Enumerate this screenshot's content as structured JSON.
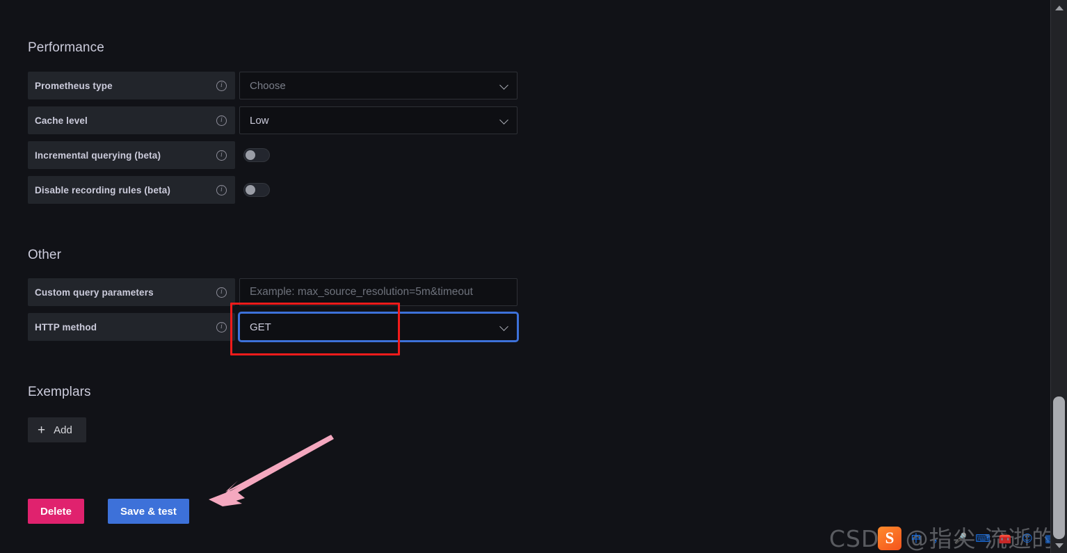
{
  "page": {
    "background": "#111217",
    "app": "Grafana Prometheus data source settings"
  },
  "sections": [
    {
      "id": "performance",
      "title": "Performance",
      "fields": [
        {
          "label": "Prometheus type",
          "info_icon": "info-icon",
          "control": "select",
          "value": "Choose",
          "is_placeholder": true,
          "focused": false
        },
        {
          "label": "Cache level",
          "info_icon": "info-icon",
          "control": "select",
          "value": "Low",
          "is_placeholder": false,
          "focused": false
        },
        {
          "label": "Incremental querying (beta)",
          "info_icon": "info-icon",
          "control": "toggle",
          "value": "off"
        },
        {
          "label": "Disable recording rules (beta)",
          "info_icon": "info-icon",
          "control": "toggle",
          "value": "off"
        }
      ]
    },
    {
      "id": "other",
      "title": "Other",
      "fields": [
        {
          "label": "Custom query parameters",
          "info_icon": "info-icon",
          "control": "text",
          "value": "",
          "placeholder": "Example: max_source_resolution=5m&timeout"
        },
        {
          "label": "HTTP method",
          "info_icon": "info-icon",
          "control": "select",
          "value": "GET",
          "is_placeholder": false,
          "focused": true
        }
      ]
    },
    {
      "id": "exemplars",
      "title": "Exemplars",
      "add_button": {
        "label": "Add",
        "icon": "plus-icon"
      }
    }
  ],
  "footer": {
    "delete_label": "Delete",
    "delete_color": "#e0226e",
    "save_label": "Save & test",
    "save_color": "#3d71d9"
  },
  "annotations": {
    "highlight_rect": {
      "target": "HTTP method dropdown",
      "color": "#f21b1b"
    },
    "arrow": {
      "target": "Save & test",
      "color": "#f4a8bf"
    }
  },
  "watermark": {
    "text": "CSDN @指尖 流逝的年华"
  },
  "ime_toolbar": {
    "logo": "sogou-logo",
    "logo_text": "S",
    "items": [
      {
        "name": "chinese-mode-icon",
        "glyph": "中"
      },
      {
        "name": "punctuation-icon",
        "glyph": "，"
      },
      {
        "name": "microphone-icon",
        "glyph": "🎤"
      },
      {
        "name": "keyboard-icon",
        "glyph": "⌨"
      },
      {
        "name": "toolbox-icon",
        "glyph": "🧰"
      },
      {
        "name": "emoji-icon",
        "glyph": "☺"
      },
      {
        "name": "apps-grid-icon",
        "glyph": "▦"
      }
    ]
  },
  "scrollbar": {
    "up_arrow": "scroll-up-arrow",
    "down_arrow": "scroll-down-arrow",
    "thumb_top_pct": 72
  }
}
